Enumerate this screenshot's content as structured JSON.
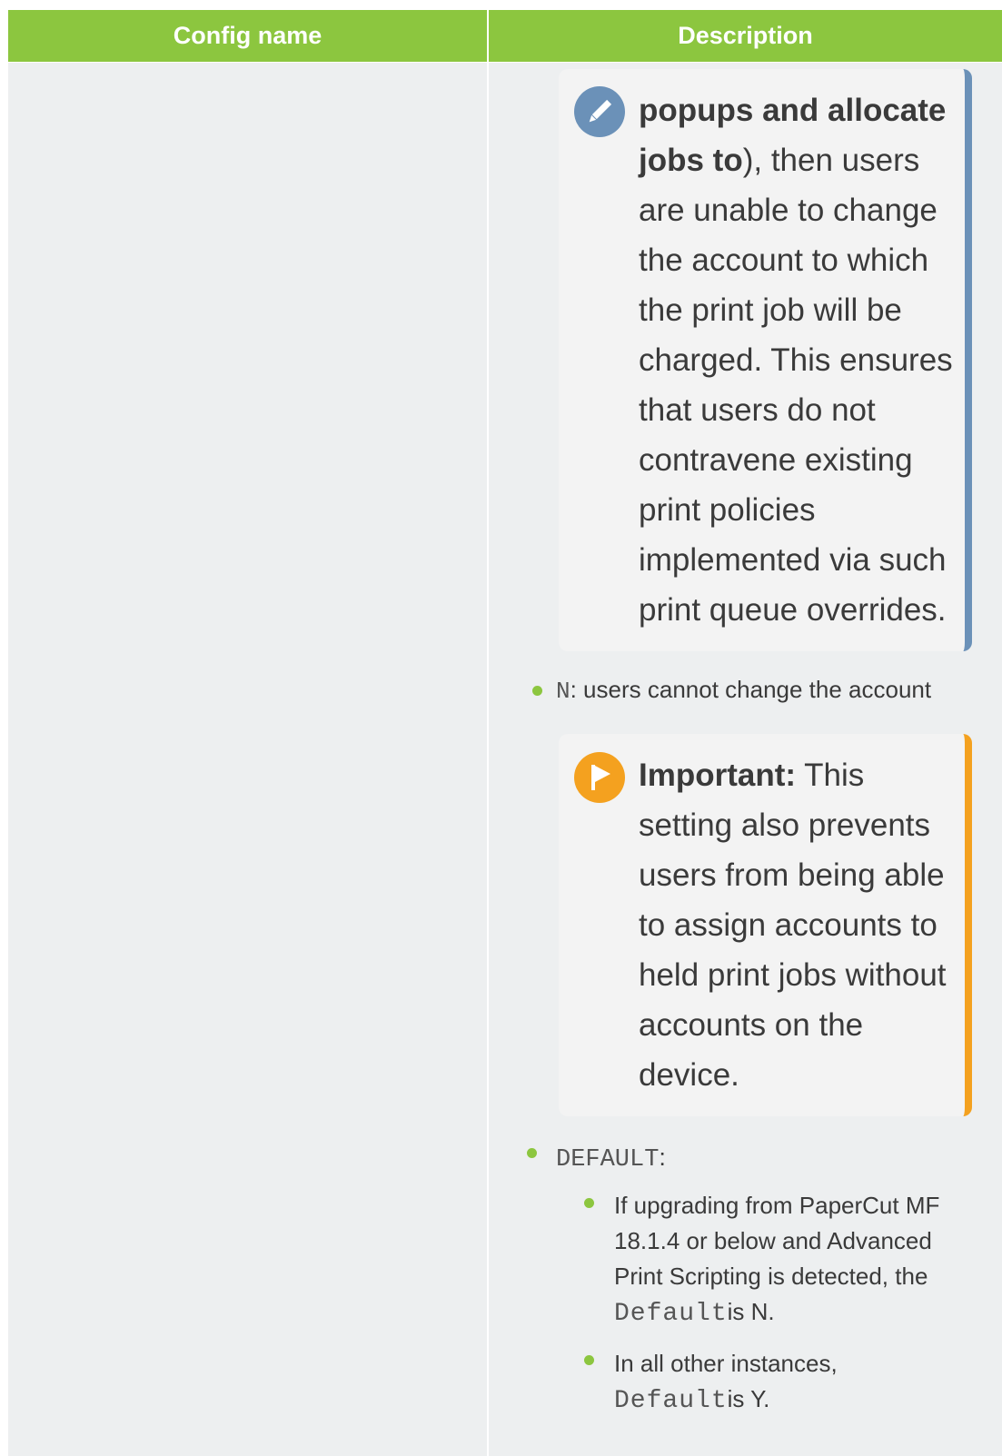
{
  "table": {
    "header_config_name": "Config name",
    "header_description": "Description"
  },
  "note1": {
    "icon": "pencil-icon",
    "color": "#6b91b8",
    "bold_a": "popups and allocate",
    "bold_b": "jobs to",
    "rest_b": "), then users",
    "lines": [
      "are unable to change",
      "the account to which",
      "the print job will be",
      "charged. This ensures",
      "that users do not",
      "contravene existing",
      "print policies",
      "implemented via such",
      "print queue overrides."
    ]
  },
  "item_n": {
    "code": "N",
    "text": ": users cannot change the account"
  },
  "note2": {
    "icon": "flag-icon",
    "color": "#f4a11f",
    "bold": "Important:",
    "rest_first": " This",
    "lines": [
      "setting also prevents",
      "users from being able",
      "to assign accounts to",
      "held print jobs without",
      "accounts on the",
      "device."
    ]
  },
  "item_default": {
    "code": "DEFAULT",
    "text": ":"
  },
  "sub1": {
    "lines": [
      "If upgrading from PaperCut MF",
      "18.1.4 or below and Advanced",
      "Print Scripting is detected, the"
    ],
    "code": "Default",
    "tail": "is N."
  },
  "sub2": {
    "line": "In all other instances,",
    "code": "Default",
    "tail": "is Y."
  },
  "colors": {
    "header": "#8cc63f",
    "cell": "#edeff0",
    "note_bg": "#f3f3f3",
    "bullet": "#8cc63f"
  }
}
